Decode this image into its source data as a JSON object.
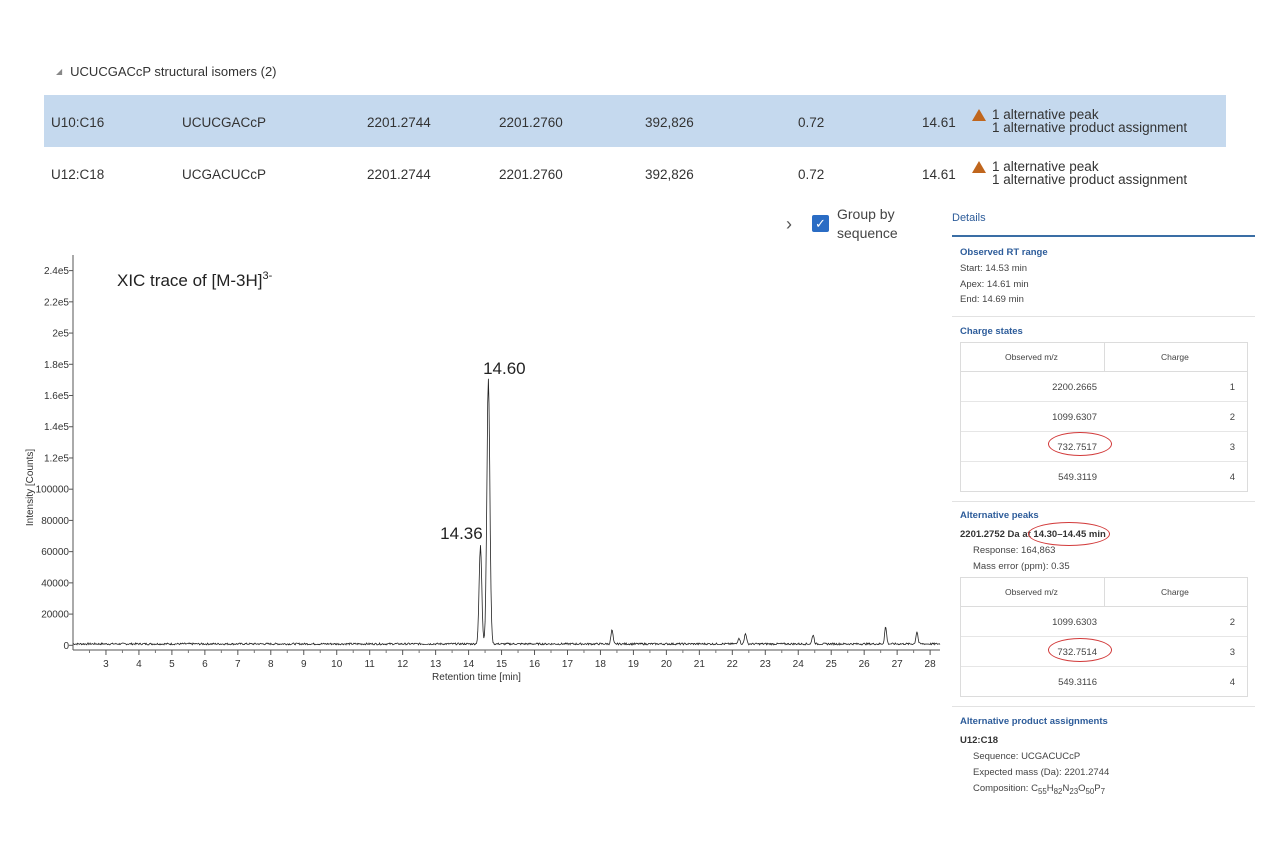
{
  "group_header": {
    "label": "UCUCGACcP structural isomers (2)"
  },
  "rows": [
    {
      "range": "U10:C16",
      "sequence": "UCUCGACcP",
      "expected_mass": "2201.2744",
      "observed_mass": "2201.2760",
      "response": "392,826",
      "mass_error": "0.72",
      "rt": "14.61",
      "msg1": "1 alternative peak",
      "msg2": "1 alternative product assignment"
    },
    {
      "range": "U12:C18",
      "sequence": "UCGACUCcP",
      "expected_mass": "2201.2744",
      "observed_mass": "2201.2760",
      "response": "392,826",
      "mass_error": "0.72",
      "rt": "14.61",
      "msg1": "1 alternative peak",
      "msg2": "1 alternative product assignment"
    }
  ],
  "controls": {
    "group_by_label": "Group by sequence",
    "group_by_checked": true
  },
  "chart_data": {
    "type": "line",
    "title": "XIC trace of [M-3H]",
    "title_superscript": "3-",
    "xlabel": "Retention time [min]",
    "ylabel": "Intensity [Counts]",
    "xlim": [
      2.0,
      28.3
    ],
    "ylim": [
      -3000,
      250000
    ],
    "x_ticks": [
      3,
      4,
      5,
      6,
      7,
      8,
      9,
      10,
      11,
      12,
      13,
      14,
      15,
      16,
      17,
      18,
      19,
      20,
      21,
      22,
      23,
      24,
      25,
      26,
      27,
      28
    ],
    "y_ticks": [
      {
        "value": 0,
        "label": "0"
      },
      {
        "value": 20000,
        "label": "20000"
      },
      {
        "value": 40000,
        "label": "40000"
      },
      {
        "value": 60000,
        "label": "60000"
      },
      {
        "value": 80000,
        "label": "80000"
      },
      {
        "value": 100000,
        "label": "100000"
      },
      {
        "value": 120000,
        "label": "1.2e5"
      },
      {
        "value": 140000,
        "label": "1.4e5"
      },
      {
        "value": 160000,
        "label": "1.6e5"
      },
      {
        "value": 180000,
        "label": "1.8e5"
      },
      {
        "value": 200000,
        "label": "2e5"
      },
      {
        "value": 220000,
        "label": "2.2e5"
      },
      {
        "value": 240000,
        "label": "2.4e5"
      }
    ],
    "peaks": [
      {
        "rt": 14.36,
        "height": 63000,
        "width": 0.04
      },
      {
        "rt": 14.6,
        "height": 170000,
        "width": 0.045
      },
      {
        "rt": 18.35,
        "height": 9000,
        "width": 0.03
      },
      {
        "rt": 22.2,
        "height": 4000,
        "width": 0.03
      },
      {
        "rt": 22.4,
        "height": 7000,
        "width": 0.03
      },
      {
        "rt": 24.45,
        "height": 6000,
        "width": 0.03
      },
      {
        "rt": 26.65,
        "height": 11000,
        "width": 0.03
      },
      {
        "rt": 27.6,
        "height": 8000,
        "width": 0.03
      }
    ],
    "annotations": [
      {
        "rt": 14.6,
        "label": "14.60"
      },
      {
        "rt": 14.36,
        "label": "14.36"
      }
    ]
  },
  "details": {
    "tab": "Details",
    "rt_range": {
      "title": "Observed RT range",
      "start": "Start: 14.53 min",
      "apex": "Apex: 14.61 min",
      "end": "End: 14.69 min"
    },
    "charge_states": {
      "title": "Charge states",
      "col1": "Observed m/z",
      "col2": "Charge",
      "rows": [
        {
          "mz": "2200.2665",
          "charge": "1"
        },
        {
          "mz": "1099.6307",
          "charge": "2"
        },
        {
          "mz": "732.7517",
          "charge": "3"
        },
        {
          "mz": "549.3119",
          "charge": "4"
        }
      ]
    },
    "alt_peaks": {
      "title": "Alternative peaks",
      "mass": "2201.2752 Da at",
      "range": "14.30–14.45 min",
      "response": "Response: 164,863",
      "error": "Mass error (ppm): 0.35",
      "col1": "Observed m/z",
      "col2": "Charge",
      "rows": [
        {
          "mz": "1099.6303",
          "charge": "2"
        },
        {
          "mz": "732.7514",
          "charge": "3"
        },
        {
          "mz": "549.3116",
          "charge": "4"
        }
      ]
    },
    "alt_products": {
      "title": "Alternative product assignments",
      "name": "U12:C18",
      "sequence": "Sequence: UCGACUCcP",
      "expected": "Expected mass (Da): 2201.2744",
      "composition_label": "Composition: ",
      "composition_parts": [
        {
          "t": "C",
          "s": "55"
        },
        {
          "t": "H",
          "s": "82"
        },
        {
          "t": "N",
          "s": "23"
        },
        {
          "t": "O",
          "s": "50"
        },
        {
          "t": "P",
          "s": "7"
        }
      ]
    }
  }
}
